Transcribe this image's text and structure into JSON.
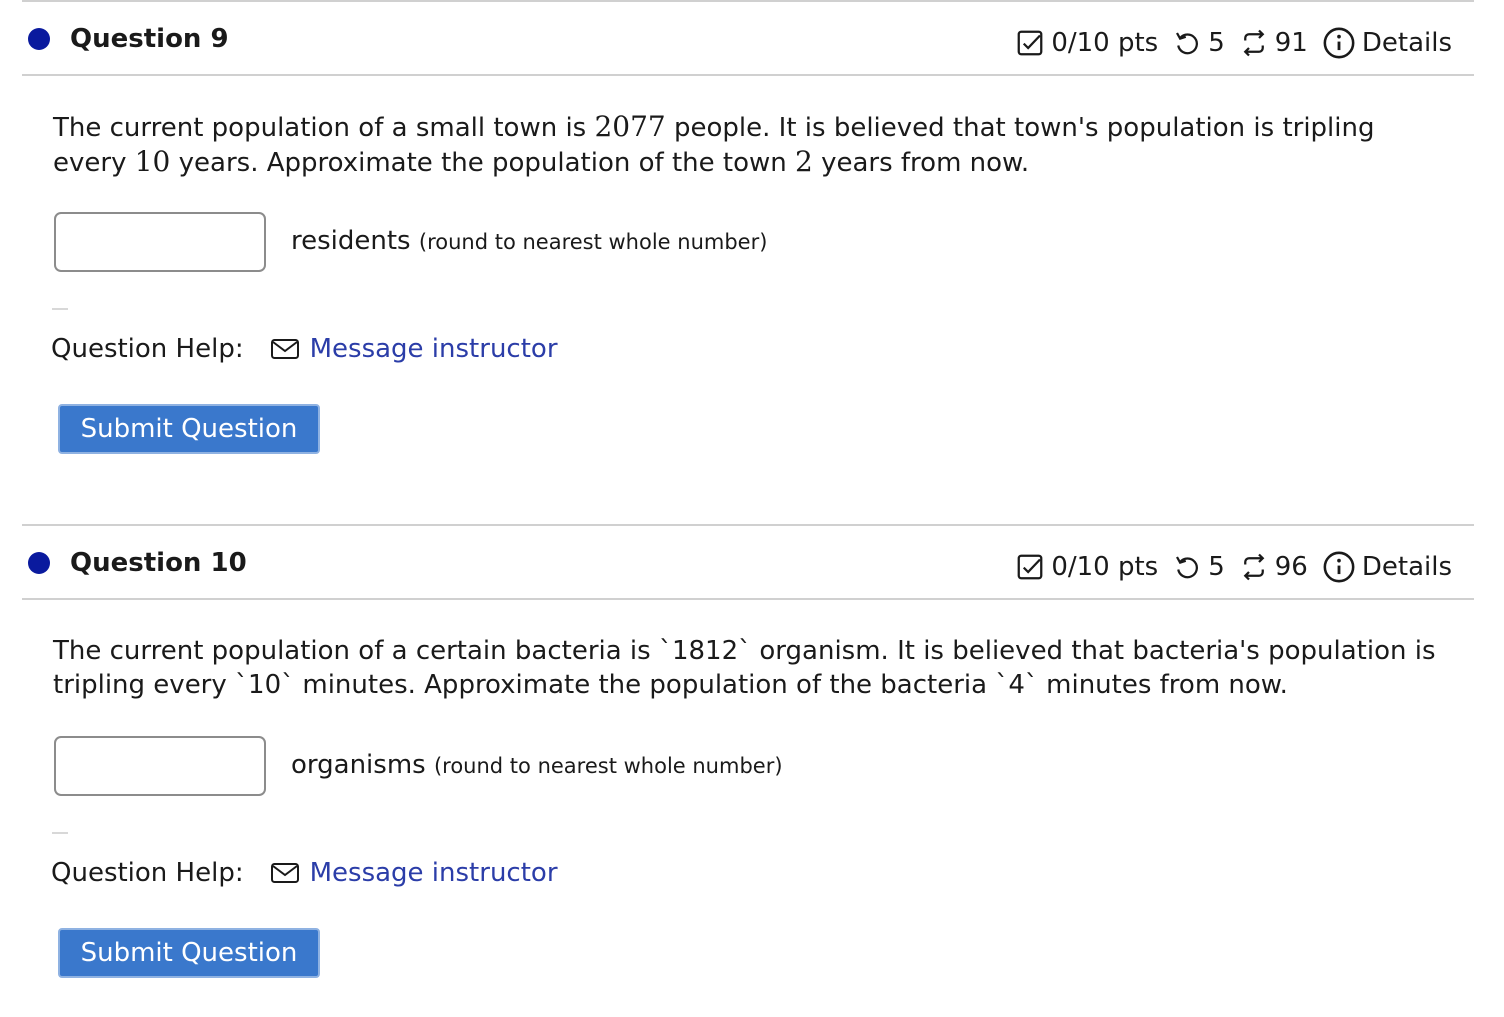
{
  "questions": [
    {
      "title": "Question 9",
      "points": "0/10 pts",
      "attempts": "5",
      "versions": "91",
      "details_label": "Details",
      "text_before_1": "The current population of a small town is ",
      "num_1": "2077",
      "text_before_2": " people. It is believed that town's population is tripling every ",
      "num_2": "10",
      "text_before_3": " years. Approximate the population of the town ",
      "num_3": "2",
      "text_after": " years from now.",
      "input_value": "",
      "unit": "residents",
      "hint": "(round to nearest whole number)",
      "help_label": "Question Help:",
      "help_link": "Message instructor",
      "submit_label": "Submit Question"
    },
    {
      "title": "Question 10",
      "points": "0/10 pts",
      "attempts": "5",
      "versions": "96",
      "details_label": "Details",
      "text": "The current population of a certain bacteria is `1812` organism. It is believed that bacteria's population is tripling every `10` minutes. Approximate the population of the bacteria `4` minutes from now.",
      "input_value": "",
      "unit": "organisms",
      "hint": "(round to nearest whole number)",
      "help_label": "Question Help:",
      "help_link": "Message instructor",
      "submit_label": "Submit Question"
    }
  ],
  "colors": {
    "dot": "#0a1a9e",
    "link": "#2b3da8",
    "button": "#3a78cc",
    "divider": "#d0d0d0"
  },
  "icons": {
    "points": "checkbox-icon",
    "attempts": "retry-icon",
    "versions": "versions-icon",
    "details": "info-icon",
    "help": "mail-icon"
  }
}
